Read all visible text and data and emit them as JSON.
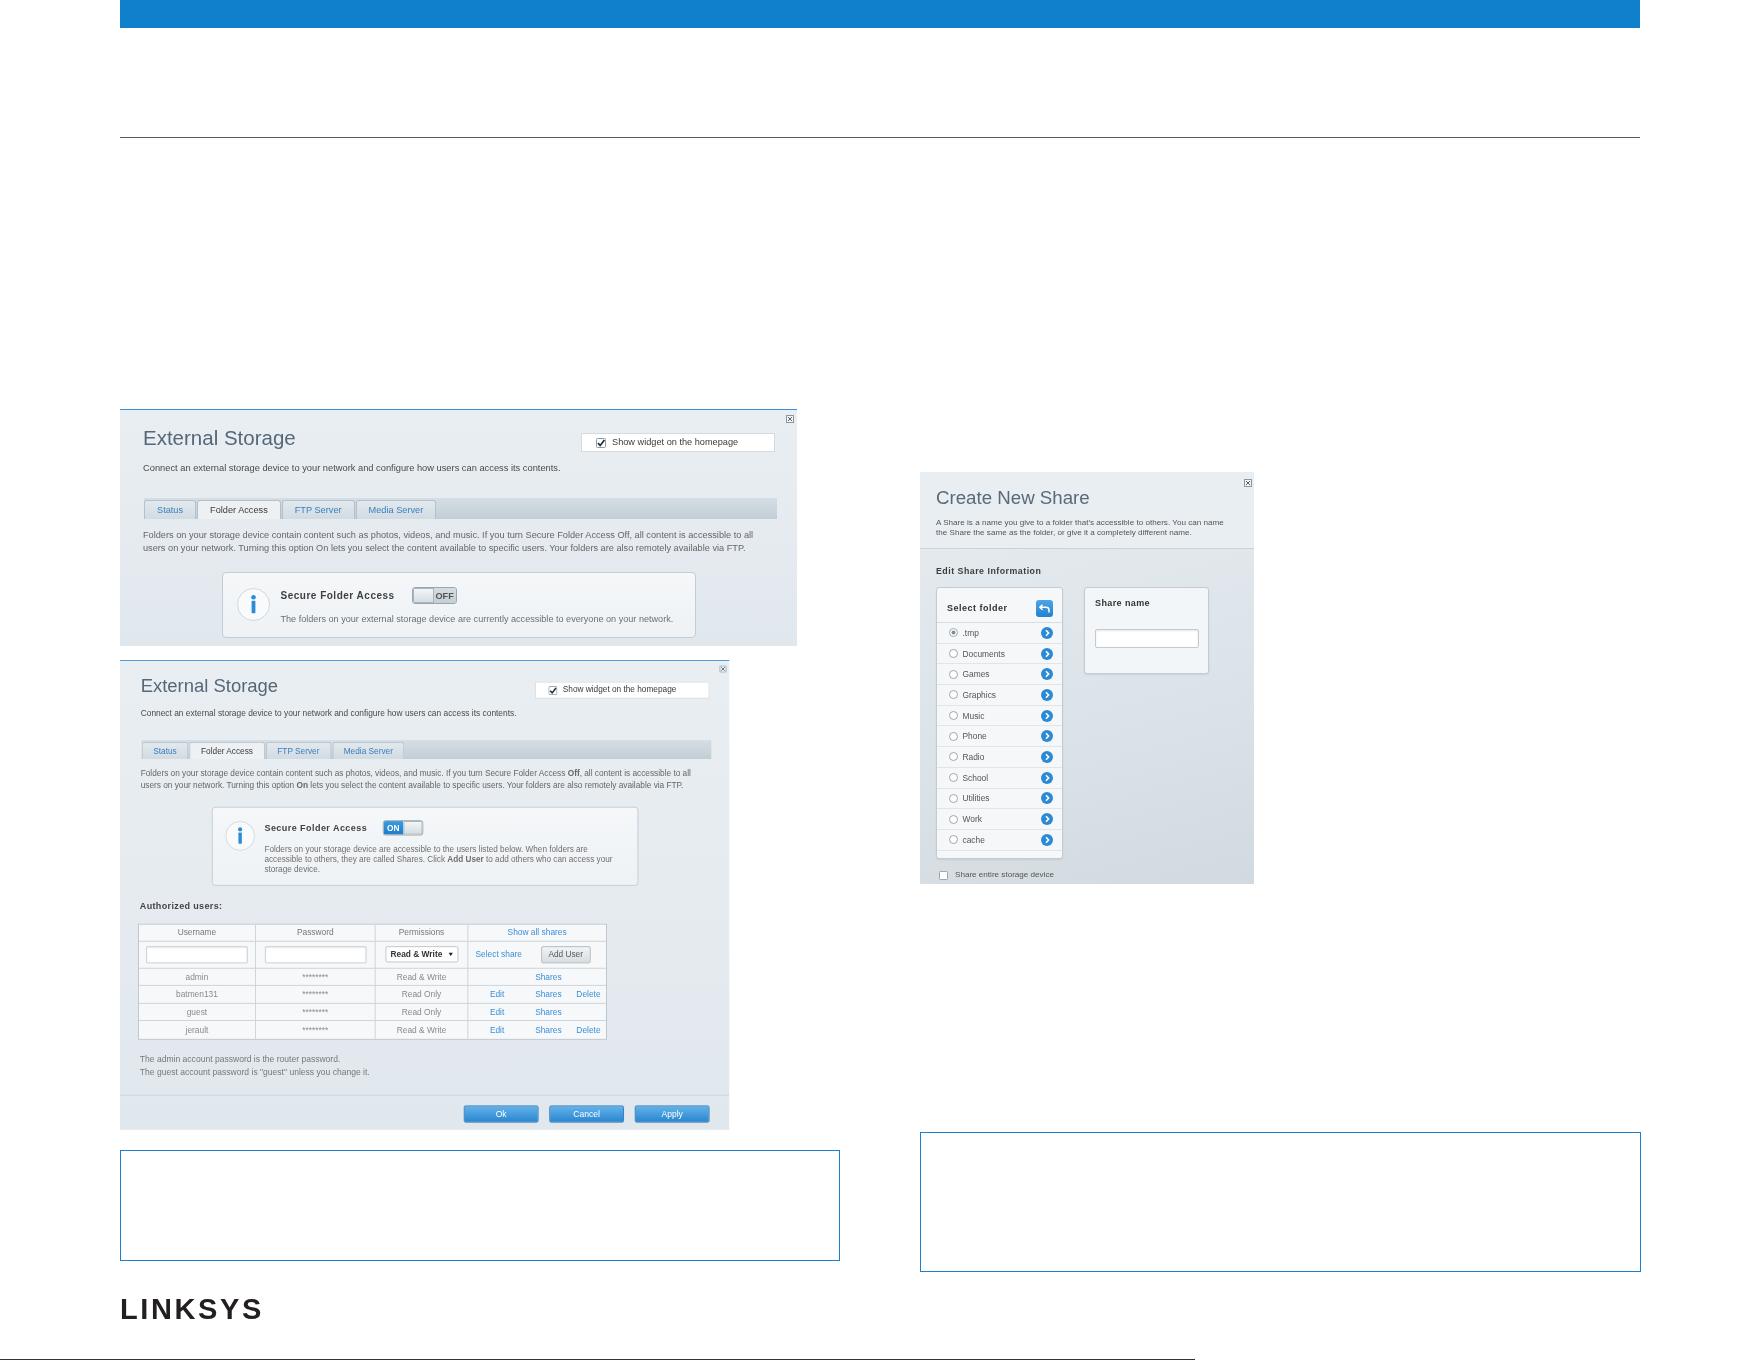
{
  "left_column": {
    "screenshots": [
      {
        "kind": "external_storage",
        "title": "External Storage",
        "widget_option": {
          "label": "Show widget on the homepage",
          "checked": true
        },
        "description": "Connect an external storage device to your network and configure how users can access its contents.",
        "tabs": [
          {
            "label": "Status",
            "selected": false
          },
          {
            "label": "Folder Access",
            "selected": true
          },
          {
            "label": "FTP Server",
            "selected": false
          },
          {
            "label": "Media Server",
            "selected": false
          }
        ],
        "intro": "Folders on your storage device contain content such as photos, videos, and music. If you turn Secure Folder Access Off, all content is accessible to all users on your network. Turning this option On lets you select the content available to specific users. Your folders are also remotely available via FTP.",
        "secure_folder_access": {
          "label": "Secure Folder Access",
          "on": false,
          "toggle_text": "OFF",
          "message": "The folders on your external storage device are currently accessible to everyone on your network."
        }
      },
      {
        "kind": "external_storage",
        "title": "External Storage",
        "widget_option": {
          "label": "Show widget on the homepage",
          "checked": true
        },
        "description": "Connect an external storage device to your network and configure how users can access its contents.",
        "tabs": [
          {
            "label": "Status",
            "selected": false
          },
          {
            "label": "Folder Access",
            "selected": true
          },
          {
            "label": "FTP Server",
            "selected": false
          },
          {
            "label": "Media Server",
            "selected": false
          }
        ],
        "intro": "Folders on your storage device contain content such as photos, videos, and music. If you turn Secure Folder Access **Off**, all content is accessible to all users on your network. Turning this option **On** lets you select the content available to specific users. Your folders are also remotely available via FTP.",
        "secure_folder_access": {
          "label": "Secure Folder Access",
          "on": true,
          "toggle_text": "ON",
          "message": "Folders on your storage device are accessible to the users listed below. When folders are accessible to others, they are called Shares. Click **Add User** to add others who can access your storage device."
        },
        "authorized_users": {
          "heading": "Authorized users:",
          "columns": [
            "Username",
            "Password",
            "Permissions"
          ],
          "show_all_shares": "Show all shares",
          "new_user": {
            "permission": "Read & Write",
            "select_share": "Select share",
            "add_button": "Add User"
          },
          "rows": [
            {
              "username": "admin",
              "password": "********",
              "permissions": "Read & Write",
              "actions": [
                {
                  "kind": "shares",
                  "label": "Shares"
                }
              ]
            },
            {
              "username": "batmen131",
              "password": "********",
              "permissions": "Read Only",
              "actions": [
                {
                  "kind": "edit",
                  "label": "Edit"
                },
                {
                  "kind": "shares",
                  "label": "Shares"
                },
                {
                  "kind": "delete",
                  "label": "Delete"
                }
              ]
            },
            {
              "username": "guest",
              "password": "********",
              "permissions": "Read Only",
              "actions": [
                {
                  "kind": "edit",
                  "label": "Edit"
                },
                {
                  "kind": "shares",
                  "label": "Shares"
                }
              ]
            },
            {
              "username": "jerault",
              "password": "********",
              "permissions": "Read & Write",
              "actions": [
                {
                  "kind": "edit",
                  "label": "Edit"
                },
                {
                  "kind": "shares",
                  "label": "Shares"
                },
                {
                  "kind": "delete",
                  "label": "Delete"
                }
              ]
            }
          ]
        },
        "notes": [
          "The admin account password is the router password.",
          "The guest account password is \"guest\" unless you change it."
        ],
        "buttons": [
          "Ok",
          "Cancel",
          "Apply"
        ]
      }
    ]
  },
  "right_column": {
    "screenshots": [
      {
        "kind": "create_share",
        "title": "Create New Share",
        "description": "A Share is a name you give to a folder that's accessible to others. You can name the Share the same as the folder, or give it a completely different name.",
        "section_heading": "Edit Share Information",
        "folder_panel": {
          "heading": "Select folder",
          "folders": [
            {
              "name": ".tmp",
              "selected": true
            },
            {
              "name": "Documents",
              "selected": false
            },
            {
              "name": "Games",
              "selected": false
            },
            {
              "name": "Graphics",
              "selected": false
            },
            {
              "name": "Music",
              "selected": false
            },
            {
              "name": "Phone",
              "selected": false
            },
            {
              "name": "Radio",
              "selected": false
            },
            {
              "name": "School",
              "selected": false
            },
            {
              "name": "Utilities",
              "selected": false
            },
            {
              "name": "Work",
              "selected": false
            },
            {
              "name": "cache",
              "selected": false
            }
          ]
        },
        "share_name_panel": {
          "label": "Share name"
        },
        "share_entire_device": {
          "label": "Share entire storage device",
          "checked": false
        }
      }
    ]
  },
  "footer": {
    "logo": "LINKSYS"
  }
}
